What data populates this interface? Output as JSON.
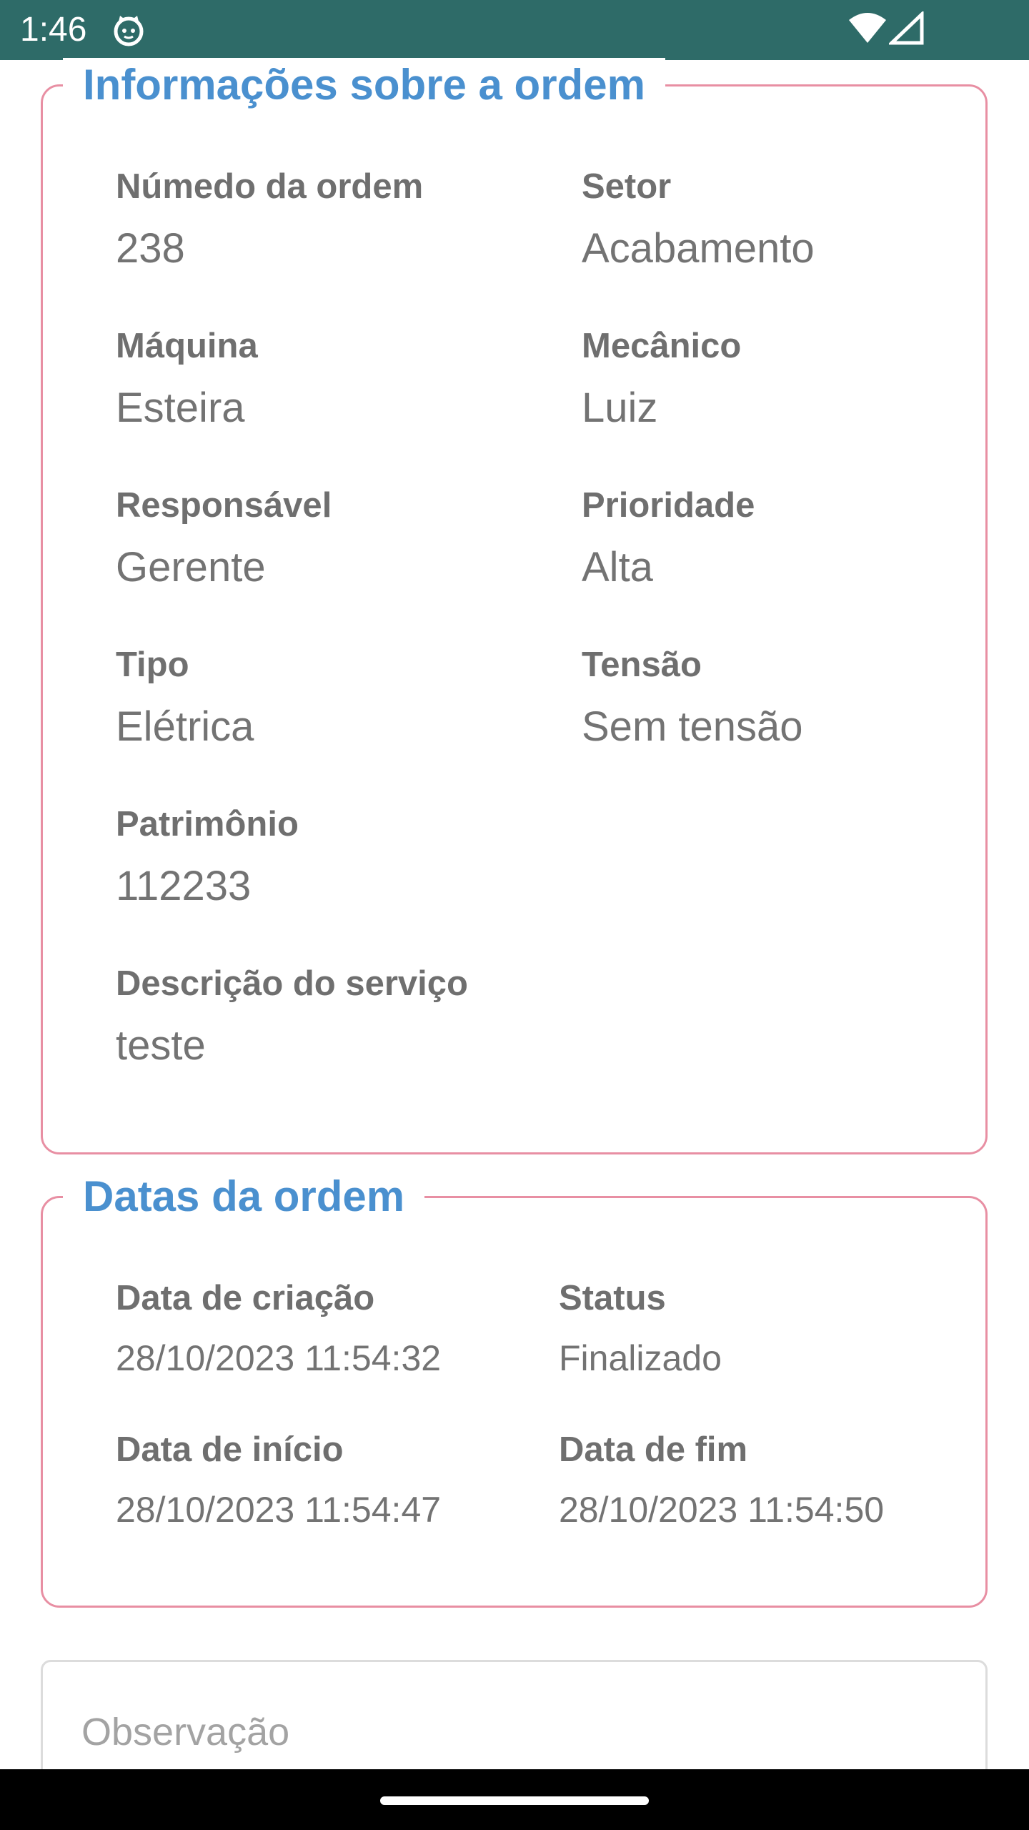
{
  "status_bar": {
    "time": "1:46",
    "background_color": "#2e6b68",
    "icons": [
      "app-notification-icon",
      "wifi-icon",
      "cell-signal-icon"
    ]
  },
  "order_info": {
    "legend": "Informações sobre a ordem",
    "border_color": "#e88fa3",
    "legend_color": "#4a90cf",
    "fields": [
      {
        "label": "Númedo da ordem",
        "value": "238"
      },
      {
        "label": "Setor",
        "value": "Acabamento"
      },
      {
        "label": "Máquina",
        "value": "Esteira"
      },
      {
        "label": "Mecânico",
        "value": "Luiz"
      },
      {
        "label": "Responsável",
        "value": "Gerente"
      },
      {
        "label": "Prioridade",
        "value": "Alta"
      },
      {
        "label": "Tipo",
        "value": "Elétrica"
      },
      {
        "label": "Tensão",
        "value": "Sem tensão"
      },
      {
        "label": "Patrimônio",
        "value": "112233"
      },
      {
        "label": "Descrição do serviço",
        "value": "teste"
      }
    ]
  },
  "order_dates": {
    "legend": "Datas da ordem",
    "fields": [
      {
        "label": "Data de criação",
        "value": "28/10/2023 11:54:32"
      },
      {
        "label": "Status",
        "value": "Finalizado"
      },
      {
        "label": "Data de início",
        "value": "28/10/2023 11:54:47"
      },
      {
        "label": "Data de fim",
        "value": "28/10/2023 11:54:50"
      }
    ]
  },
  "observation": {
    "placeholder": "Observação"
  }
}
